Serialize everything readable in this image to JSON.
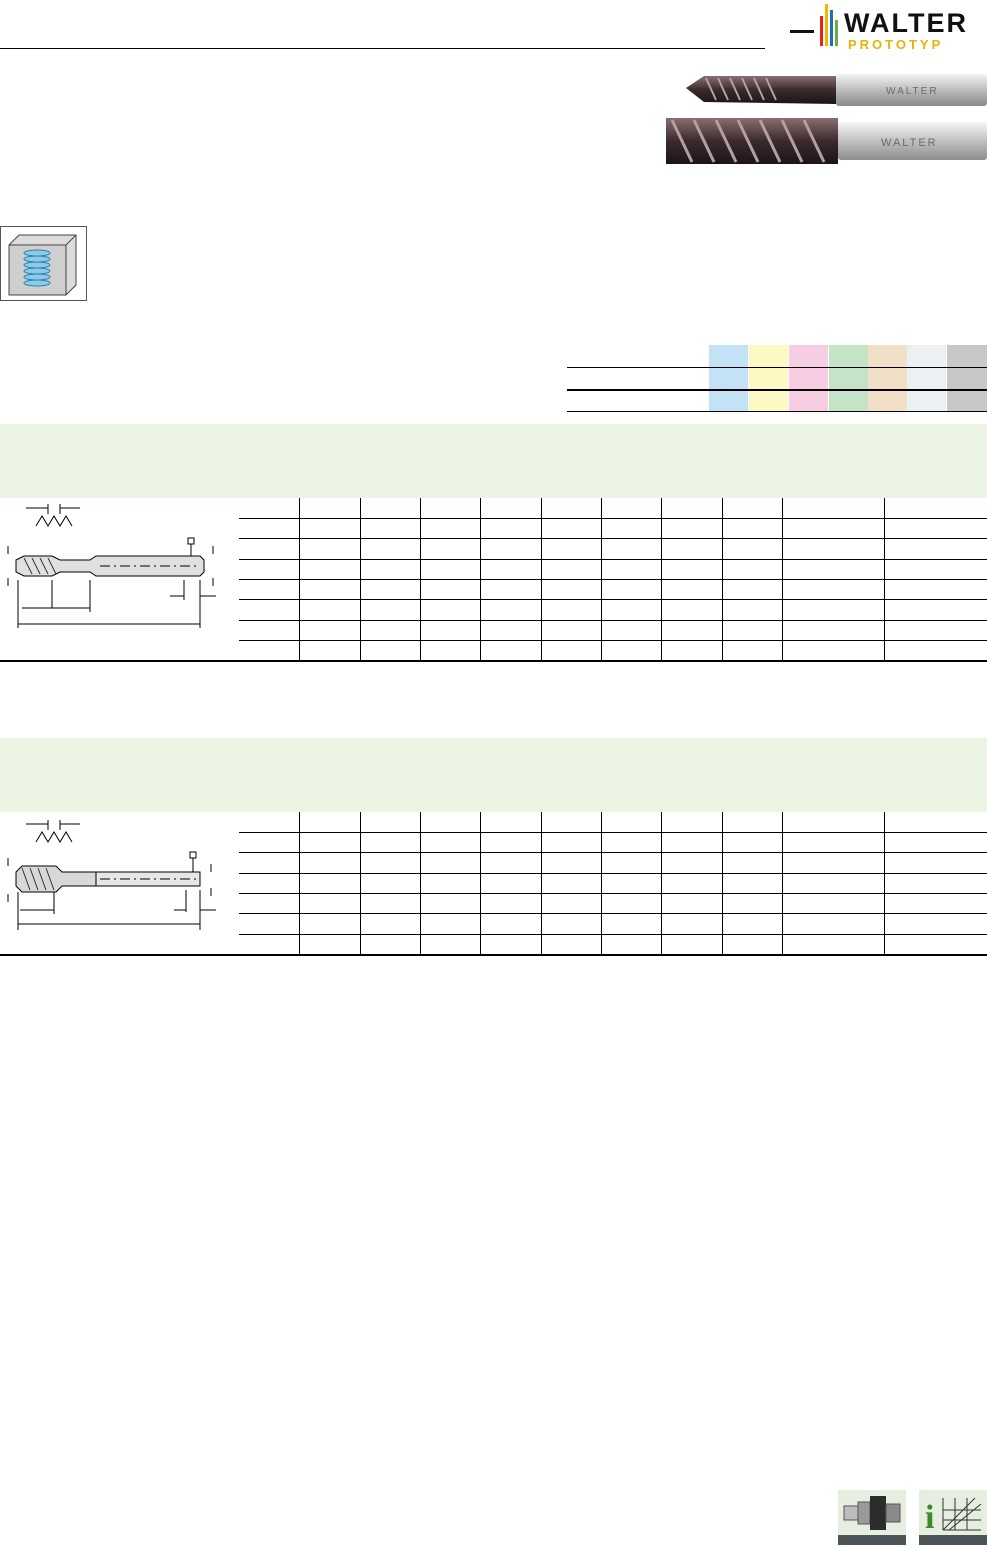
{
  "brand": {
    "logo_word": "WALTER",
    "logo_sub": "PROTOTYP",
    "bar_colors": [
      "#e1251b",
      "#f2b705",
      "#1e6fb5",
      "#6cae3e"
    ]
  },
  "material_groups": {
    "colors": [
      "#c4e2f5",
      "#fdf9c5",
      "#f7cde4",
      "#c5e3c7",
      "#f1dfc7",
      "#ecf0f3",
      "#c7c8c9"
    ]
  },
  "colors": {
    "band_green": "#ecf4e4",
    "footer_base": "#4d5457"
  },
  "icons": {
    "footer": [
      "tool-holder-icon",
      "info-diagram-icon"
    ]
  }
}
